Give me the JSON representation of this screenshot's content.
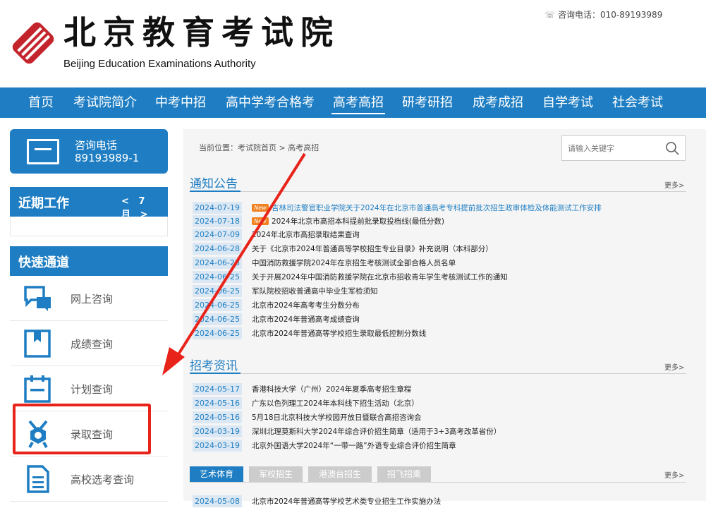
{
  "header": {
    "logo_cn": "北京教育考试院",
    "logo_en": "Beijing Education Examinations Authority",
    "hotline": "咨询电话：010-89193989",
    "colors": {
      "brand_blue": "#1f7ec3",
      "logo_red": "#c4252c",
      "highlight_red": "#e8231a"
    }
  },
  "nav": {
    "items": [
      "首页",
      "考试院简介",
      "中考中招",
      "高中学考合格考",
      "高考高招",
      "研考研招",
      "成考成招",
      "自学考试",
      "社会考试"
    ],
    "active": "高考高招"
  },
  "sidebar": {
    "hotline_l1": "咨询电话",
    "hotline_l2": "89193989-1",
    "recent_title": "近期工作",
    "month_prev": "<",
    "month": "7月",
    "month_next": ">",
    "quick_title": "快速通道",
    "quick_items": [
      {
        "label": "网上咨询",
        "icon": "chat-icon"
      },
      {
        "label": "成绩查询",
        "icon": "bookmark-icon"
      },
      {
        "label": "计划查询",
        "icon": "calendar-icon"
      },
      {
        "label": "录取查询",
        "icon": "medal-icon"
      },
      {
        "label": "高校选考查询",
        "icon": "document-icon"
      }
    ]
  },
  "main": {
    "breadcrumb": "当前位置：考试院首页 > 高考高招",
    "search_placeholder": "请输入关键字",
    "more": "更多>",
    "notice": {
      "title": "通知公告",
      "rows": [
        {
          "date": "2024-07-19",
          "new": "New",
          "text": "吉林司法警官职业学院关于2024年在北京市普通高考专科提前批次招生政审体检及体能测试工作安排"
        },
        {
          "date": "2024-07-18",
          "new": "New",
          "text": "2024年北京市高招本科提前批录取投档线(最低分数)"
        },
        {
          "date": "2024-07-09",
          "text": "2024年北京市高招录取结果查询"
        },
        {
          "date": "2024-06-28",
          "text": "关于《北京市2024年普通高等学校招生专业目录》补充说明（本科部分）"
        },
        {
          "date": "2024-06-28",
          "text": "中国消防救援学院2024年在京招生考核测试全部合格人员名单"
        },
        {
          "date": "2024-06-25",
          "text": "关于开展2024年中国消防救援学院在北京市招收青年学生考核测试工作的通知"
        },
        {
          "date": "2024-06-25",
          "text": "军队院校招收普通高中毕业生军检须知"
        },
        {
          "date": "2024-06-25",
          "text": "北京市2024年高考考生分数分布"
        },
        {
          "date": "2024-06-25",
          "text": "北京市2024年普通高考成绩查询"
        },
        {
          "date": "2024-06-25",
          "text": "北京市2024年普通高等学校招生录取最低控制分数线"
        }
      ]
    },
    "info": {
      "title": "招考资讯",
      "rows": [
        {
          "date": "2024-05-17",
          "text": "香港科技大学（广州）2024年夏季高考招生章程"
        },
        {
          "date": "2024-05-16",
          "text": "广东以色列理工2024年本科线下招生活动（北京）"
        },
        {
          "date": "2024-05-16",
          "text": "5月18日北京科技大学校园开放日暨联合高招咨询会"
        },
        {
          "date": "2024-03-19",
          "text": "深圳北理莫斯科大学2024年综合评价招生简章（适用于3+3高考改革省份）"
        },
        {
          "date": "2024-03-19",
          "text": "北京外国语大学2024年“一带一路”外语专业综合评价招生简章"
        }
      ]
    },
    "tabs": [
      "艺术体育",
      "军校招生",
      "港澳台招生",
      "招飞招乘"
    ],
    "tabs_active": "艺术体育",
    "tab_rows": [
      {
        "date": "2024-05-08",
        "text": "北京市2024年普通高等学校艺术类专业招生工作实施办法"
      }
    ]
  }
}
